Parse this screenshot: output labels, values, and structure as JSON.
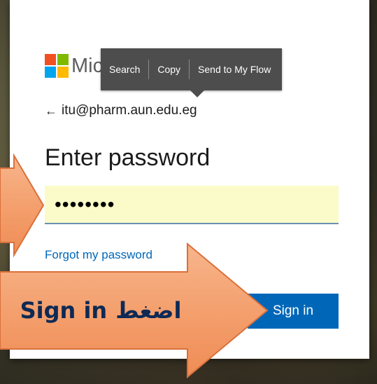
{
  "brand": {
    "name_visible": "Micr",
    "logo_colors": [
      "#f25022",
      "#7fba00",
      "#00a4ef",
      "#ffb900"
    ]
  },
  "context_menu": {
    "items": [
      "Search",
      "Copy",
      "Send to My Flow"
    ]
  },
  "account": {
    "back_icon": "left-arrow-icon",
    "email": "itu@pharm.aun.edu.eg"
  },
  "form": {
    "title": "Enter password",
    "password_value": "••••••••",
    "forgot_link": "Forgot my password",
    "signin_label": "Sign in"
  },
  "annotation": {
    "instruction_en": "Sign in",
    "instruction_ar": "اضغط",
    "arrow_color": "#f4a06e"
  },
  "colors": {
    "accent": "#0067b8",
    "autofill_bg": "#fbfbc9",
    "tooltip_bg": "#4d4d4d"
  }
}
